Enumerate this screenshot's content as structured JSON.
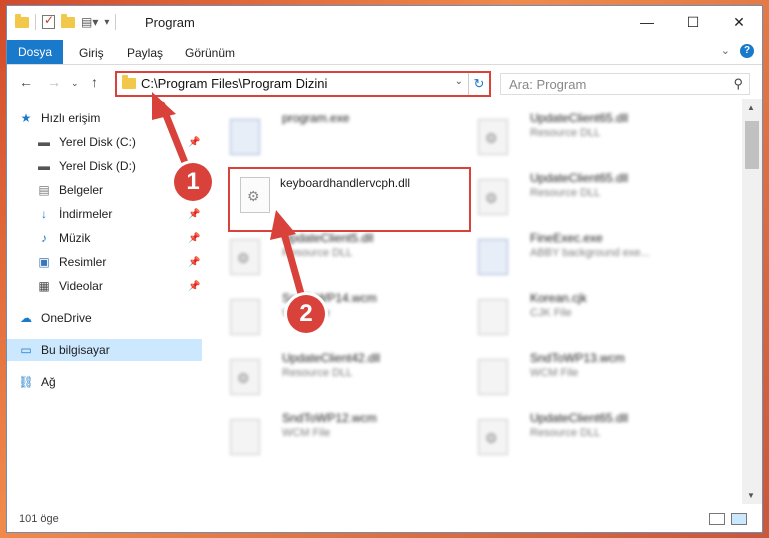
{
  "titlebar": {
    "title": "Program",
    "minimize": "—",
    "maximize": "☐",
    "close": "✕"
  },
  "ribbon": {
    "tabs": [
      "Dosya",
      "Giriş",
      "Paylaş",
      "Görünüm"
    ]
  },
  "nav": {
    "address": "C:\\Program Files\\Program Dizini",
    "search_placeholder": "Ara: Program"
  },
  "sidebar": {
    "items": [
      {
        "label": "Hızlı erişim"
      },
      {
        "label": "Yerel Disk (C:)"
      },
      {
        "label": "Yerel Disk (D:)"
      },
      {
        "label": "Belgeler"
      },
      {
        "label": "İndirmeler"
      },
      {
        "label": "Müzik"
      },
      {
        "label": "Resimler"
      },
      {
        "label": "Videolar"
      },
      {
        "label": "OneDrive"
      },
      {
        "label": "Bu bilgisayar"
      },
      {
        "label": "Ağ"
      }
    ]
  },
  "files": {
    "highlighted": {
      "name": "keyboardhandlervcph.dll"
    },
    "left": [
      {
        "name": "program.exe",
        "type": ""
      },
      {
        "name": "UpdateClient5.dll",
        "type": "Resource DLL"
      },
      {
        "name": "SndToWP14.wcm",
        "type": "WCM File"
      },
      {
        "name": "UpdateClient42.dll",
        "type": "Resource DLL"
      },
      {
        "name": "SndToWP12.wcm",
        "type": "WCM File"
      }
    ],
    "right": [
      {
        "name": "UpdateClient65.dll",
        "type": "Resource DLL"
      },
      {
        "name": "UpdateClient65.dll",
        "type": "Resource DLL"
      },
      {
        "name": "FineExec.exe",
        "type": "ABBY background exe..."
      },
      {
        "name": "Korean.cjk",
        "type": "CJK File"
      },
      {
        "name": "SndToWP13.wcm",
        "type": "WCM File"
      },
      {
        "name": "UpdateClient65.dll",
        "type": "Resource DLL"
      }
    ]
  },
  "status": {
    "count": "101 öge"
  },
  "annotations": {
    "step1": "1",
    "step2": "2"
  },
  "colors": {
    "accent": "#1979ca",
    "annotation": "#d9423a"
  }
}
